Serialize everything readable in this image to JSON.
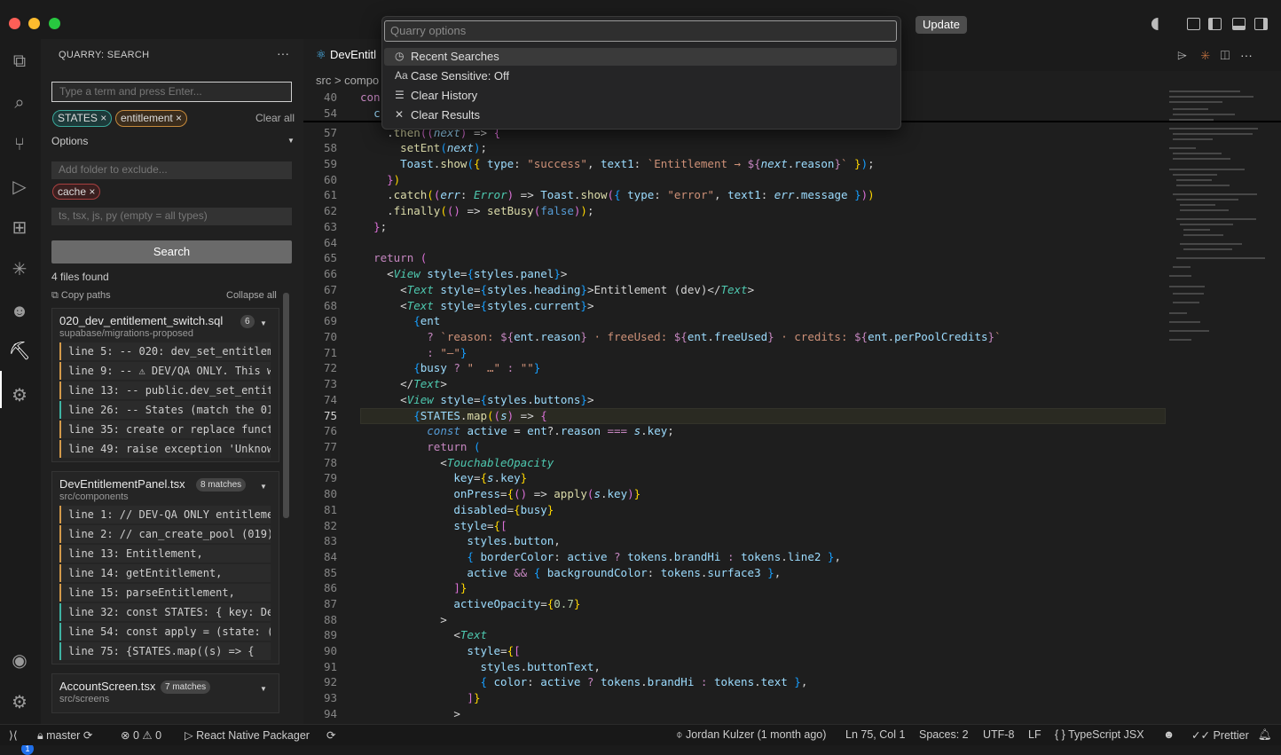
{
  "window": {
    "update_label": "Update"
  },
  "quick_pick": {
    "placeholder": "Quarry options",
    "items": [
      {
        "icon": "history-icon",
        "label": "Recent Searches"
      },
      {
        "icon": "case-sensitive-icon",
        "label": "Case Sensitive: Off"
      },
      {
        "icon": "clear-all-icon",
        "label": "Clear History"
      },
      {
        "icon": "close-icon",
        "label": "Clear Results"
      }
    ]
  },
  "sidebar": {
    "title": "QUARRY: SEARCH",
    "search_placeholder": "Type a term and press Enter...",
    "chips": [
      {
        "label": "STATES"
      },
      {
        "label": "entitlement"
      }
    ],
    "clear_all": "Clear all",
    "options_label": "Options",
    "exclude_placeholder": "Add folder to exclude...",
    "exclude_chip": "cache",
    "types_placeholder": "ts, tsx, js, py (empty = all types)",
    "search_button": "Search",
    "files_found": "4 files found",
    "copy_paths": "Copy paths",
    "collapse_all": "Collapse all",
    "files": [
      {
        "name": "020_dev_entitlement_switch.sql",
        "count": "6",
        "path": "supabase/migrations-proposed",
        "matches": [
          "line 5: -- 020: dev_set_entitleme...",
          "line 9: -- ⚠ DEV/QA ONLY. This w...",
          "line 13: -- public.dev_set_entitl...",
          "line 26: -- States (match the 01...",
          "line 35: create or replace funct...",
          "line 49: raise exception 'Unknow..."
        ]
      },
      {
        "name": "DevEntitlementPanel.tsx",
        "count": "8 matches",
        "path": "src/components",
        "matches": [
          "line 1: // DEV-QA ONLY entitlemen...",
          "line 2: // can_create_pool (019) ...",
          "line 13: Entitlement,",
          "line 14: getEntitlement,",
          "line 15: parseEntitlement,",
          "line 32: const STATES: { key: Dev...",
          "line 54: const apply = (state: (...",
          "line 75: {STATES.map((s) => {"
        ]
      },
      {
        "name": "AccountScreen.tsx",
        "count": "7 matches",
        "path": "src/screens",
        "matches": []
      }
    ]
  },
  "editor": {
    "tab_label": "DevEntitl",
    "breadcrumb": "src > compo",
    "line_numbers": [
      "40",
      "54",
      "57",
      "58",
      "59",
      "60",
      "61",
      "62",
      "63",
      "64",
      "65",
      "66",
      "67",
      "68",
      "69",
      "70",
      "71",
      "72",
      "73",
      "74",
      "75",
      "76",
      "77",
      "78",
      "79",
      "80",
      "81",
      "82",
      "83",
      "84",
      "85",
      "86",
      "87",
      "88",
      "89",
      "90",
      "91",
      "92",
      "93",
      "94"
    ],
    "current_line": "75"
  },
  "statusbar": {
    "branch": "master",
    "errors": "0",
    "warnings": "0",
    "packager": "React Native Packager",
    "blame": "Jordan Kulzer (1 month ago)",
    "position": "Ln 75, Col 1",
    "spaces": "Spaces: 2",
    "encoding": "UTF-8",
    "eol": "LF",
    "language": "TypeScript JSX",
    "formatter": "Prettier",
    "notification_count": "1"
  }
}
